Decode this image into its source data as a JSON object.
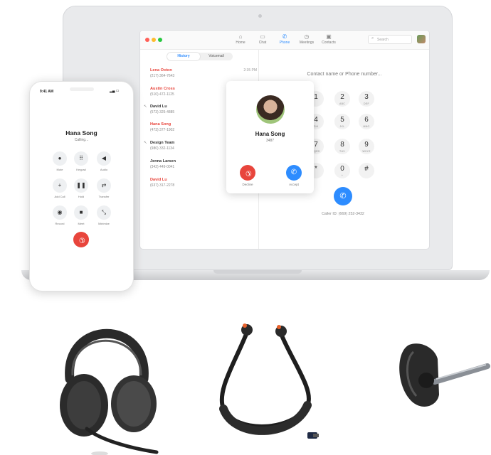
{
  "desktop_app": {
    "nav": [
      {
        "label": "Home",
        "icon": "home-icon"
      },
      {
        "label": "Chat",
        "icon": "chat-icon"
      },
      {
        "label": "Phone",
        "icon": "phone-icon",
        "active": true
      },
      {
        "label": "Meetings",
        "icon": "clock-icon"
      },
      {
        "label": "Contacts",
        "icon": "contacts-icon"
      }
    ],
    "search_placeholder": "Search",
    "tabs": [
      {
        "label": "History",
        "active": true
      },
      {
        "label": "Voicemail",
        "active": false
      }
    ],
    "history": [
      {
        "name": "Lena Oxton",
        "number": "(217) 364-7643",
        "missed": true,
        "time": "2:35 PM"
      },
      {
        "name": "Austin Cross",
        "number": "(510) 472-1125",
        "missed": true
      },
      {
        "name": "David Lu",
        "number": "(573) 325-4885",
        "missed": false,
        "outgoing": true
      },
      {
        "name": "Hana Song",
        "number": "(473) 377-1902",
        "missed": true
      },
      {
        "name": "Design Team",
        "number": "(980) 332-1134",
        "missed": false,
        "outgoing": true
      },
      {
        "name": "Jenna Larsen",
        "number": "(342) 449-0041",
        "missed": false
      },
      {
        "name": "David Lu",
        "number": "(637) 317-2278",
        "missed": true
      }
    ],
    "dial_placeholder": "Contact name or Phone number...",
    "keypad": [
      {
        "digit": "1",
        "letters": ""
      },
      {
        "digit": "2",
        "letters": "ABC"
      },
      {
        "digit": "3",
        "letters": "DEF"
      },
      {
        "digit": "4",
        "letters": "GHI"
      },
      {
        "digit": "5",
        "letters": "JKL"
      },
      {
        "digit": "6",
        "letters": "MNO"
      },
      {
        "digit": "7",
        "letters": "PQRS"
      },
      {
        "digit": "8",
        "letters": "TUV"
      },
      {
        "digit": "9",
        "letters": "WXYZ"
      },
      {
        "digit": "*",
        "letters": ""
      },
      {
        "digit": "0",
        "letters": "+"
      },
      {
        "digit": "#",
        "letters": ""
      }
    ],
    "caller_id": "Caller ID: (669) 252-3432",
    "incoming_call": {
      "name": "Hana Song",
      "ext": "3487",
      "decline_label": "Decline",
      "accept_label": "Accept"
    }
  },
  "phone": {
    "time": "9:41 AM",
    "contact_name": "Hana Song",
    "status": "Calling...",
    "controls": [
      {
        "label": "Mute",
        "icon": "mic-icon"
      },
      {
        "label": "Keypad",
        "icon": "keypad-icon"
      },
      {
        "label": "Audio",
        "icon": "speaker-icon"
      },
      {
        "label": "Add Call",
        "icon": "plus-icon"
      },
      {
        "label": "Hold",
        "icon": "pause-icon"
      },
      {
        "label": "Transfer",
        "icon": "transfer-icon"
      },
      {
        "label": "Record",
        "icon": "record-icon"
      },
      {
        "label": "Meet",
        "icon": "video-icon"
      },
      {
        "label": "Minimize",
        "icon": "minimize-icon"
      }
    ]
  },
  "colors": {
    "accent_blue": "#2d8cff",
    "decline_red": "#e8453c"
  }
}
